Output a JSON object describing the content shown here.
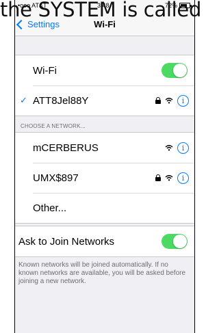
{
  "overlay_text": "the SYSTEM is called",
  "status_bar": {
    "carrier": "•ooo AT&T",
    "time": "3:48",
    "battery": "72%"
  },
  "nav": {
    "back_label": "Settings",
    "title": "Wi-Fi"
  },
  "wifi_group": {
    "wifi_label": "Wi-Fi",
    "wifi_enabled": true,
    "connected_network": "ATT8Jel88Y",
    "connected_secured": true
  },
  "networks_section": {
    "header": "CHOOSE A NETWORK...",
    "networks": [
      {
        "name": "mCERBERUS",
        "secured": false
      },
      {
        "name": "UMX$897",
        "secured": true
      }
    ],
    "other_label": "Other..."
  },
  "ask_group": {
    "label": "Ask to Join Networks",
    "enabled": true,
    "note": "Known networks will be joined automatically. If no known networks are available, you will be asked before joining a new network."
  },
  "colors": {
    "accent": "#007aff",
    "toggle_on": "#4cd964",
    "background": "#efeff4"
  },
  "icons": [
    "chevron-left-icon",
    "checkmark-icon",
    "lock-icon",
    "wifi-icon",
    "info-icon",
    "battery-icon"
  ]
}
